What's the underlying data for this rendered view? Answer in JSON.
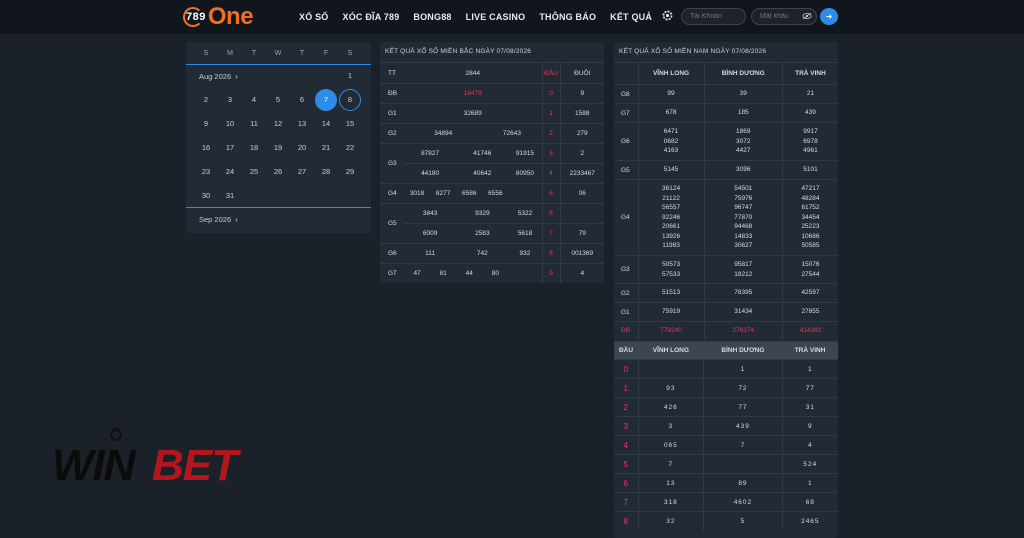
{
  "nav": {
    "logo_number": "789",
    "logo_word": "One",
    "items": [
      "XỔ SỐ",
      "XÓC ĐĨA 789",
      "BONG88",
      "LIVE CASINO",
      "THÔNG BÁO",
      "KẾT QUẢ"
    ],
    "username_placeholder": "Tài Khoản",
    "password_placeholder": "Mật khẩu",
    "login_icon": "arrow-right-icon",
    "settings_icon": "gear-icon",
    "eye_icon": "eye-off-icon"
  },
  "calendar": {
    "weekdays": [
      "S",
      "M",
      "T",
      "W",
      "T",
      "F",
      "S"
    ],
    "current_month": "Aug 2026",
    "next_month": "Sep 2026",
    "days": [
      "",
      "",
      "",
      "",
      "",
      "",
      "1",
      "2",
      "3",
      "4",
      "5",
      "6",
      "7",
      "8",
      "9",
      "10",
      "11",
      "12",
      "13",
      "14",
      "15",
      "16",
      "17",
      "18",
      "19",
      "20",
      "21",
      "22",
      "23",
      "24",
      "25",
      "26",
      "27",
      "28",
      "29",
      "30",
      "31"
    ],
    "selected_day": "7",
    "today_day": "8",
    "accent_color": "#2f8be8"
  },
  "mien_bac": {
    "title": "KẾT QUẢ XỔ SỐ MIỀN BẮC NGÀY 07/08/2026",
    "header": {
      "tt": "TT",
      "code": "2844",
      "dau": "ĐẦU",
      "duoi": "ĐUÔI"
    },
    "rows": [
      {
        "label": "ĐB",
        "values": [
          "16479"
        ],
        "red": true
      },
      {
        "label": "G1",
        "values": [
          "32689"
        ]
      },
      {
        "label": "G2",
        "values": [
          "34894",
          "72643"
        ]
      },
      {
        "label": "G3",
        "values": [
          "87827",
          "41746",
          "91915",
          "44180",
          "40642",
          "80950"
        ]
      },
      {
        "label": "G4",
        "values": [
          "3018",
          "8277",
          "6586",
          "6556"
        ]
      },
      {
        "label": "G5",
        "values": [
          "3843",
          "9329",
          "5322",
          "6009",
          "2583",
          "5618"
        ]
      },
      {
        "label": "G6",
        "values": [
          "111",
          "742",
          "932"
        ]
      },
      {
        "label": "G7",
        "values": [
          "47",
          "81",
          "44",
          "80"
        ]
      }
    ],
    "dau_duoi": [
      {
        "dau": "0",
        "duoi": "9"
      },
      {
        "dau": "1",
        "duoi": "1588"
      },
      {
        "dau": "2",
        "duoi": "279"
      },
      {
        "dau": "3",
        "duoi": "2"
      },
      {
        "dau": "4",
        "duoi": "2233467"
      },
      {
        "dau": "5",
        "duoi": "06"
      },
      {
        "dau": "6",
        "duoi": ""
      },
      {
        "dau": "7",
        "duoi": "79"
      },
      {
        "dau": "8",
        "duoi": "001369"
      },
      {
        "dau": "9",
        "duoi": "4"
      }
    ]
  },
  "mien_nam": {
    "title": "KẾT QUẢ XỔ SỐ MIỀN NAM NGÀY 07/08/2026",
    "provinces": [
      "VĨNH LONG",
      "BÌNH DƯƠNG",
      "TRÀ VINH"
    ],
    "rows": [
      {
        "label": "G8",
        "cells": [
          [
            "99"
          ],
          [
            "39"
          ],
          [
            "21"
          ]
        ]
      },
      {
        "label": "G7",
        "cells": [
          [
            "678"
          ],
          [
            "185"
          ],
          [
            "439"
          ]
        ]
      },
      {
        "label": "G6",
        "cells": [
          [
            "6471",
            "0682",
            "4163"
          ],
          [
            "1869",
            "3072",
            "4427"
          ],
          [
            "9917",
            "6978",
            "4961"
          ]
        ]
      },
      {
        "label": "G5",
        "cells": [
          [
            "5145"
          ],
          [
            "3096"
          ],
          [
            "5101"
          ]
        ]
      },
      {
        "label": "G4",
        "cells": [
          [
            "36124",
            "21122",
            "56557",
            "92246",
            "20661",
            "13926",
            "11983"
          ],
          [
            "54501",
            "75976",
            "96747",
            "77870",
            "94468",
            "14833",
            "30627"
          ],
          [
            "47217",
            "48284",
            "61752",
            "34454",
            "25223",
            "10686",
            "50585"
          ]
        ]
      },
      {
        "label": "G3",
        "cells": [
          [
            "50573",
            "57533"
          ],
          [
            "95817",
            "18212"
          ],
          [
            "15076",
            "27544"
          ]
        ]
      },
      {
        "label": "G2",
        "cells": [
          [
            "51513"
          ],
          [
            "78395"
          ],
          [
            "42597"
          ]
        ]
      },
      {
        "label": "G1",
        "cells": [
          [
            "75919"
          ],
          [
            "31434"
          ],
          [
            "27855"
          ]
        ]
      },
      {
        "label": "ĐB",
        "cells": [
          [
            "779240"
          ],
          [
            "276374"
          ],
          [
            "414382"
          ]
        ],
        "red": true
      }
    ],
    "dau_header": "ĐẦU",
    "dau_rows": [
      {
        "dau": "0",
        "values": [
          "",
          "1",
          "1"
        ]
      },
      {
        "dau": "1",
        "values": [
          "93",
          "72",
          "77"
        ]
      },
      {
        "dau": "2",
        "values": [
          "426",
          "77",
          "31"
        ]
      },
      {
        "dau": "3",
        "values": [
          "3",
          "439",
          "9"
        ]
      },
      {
        "dau": "4",
        "values": [
          "065",
          "7",
          "4"
        ]
      },
      {
        "dau": "5",
        "values": [
          "7",
          "",
          "524"
        ]
      },
      {
        "dau": "6",
        "values": [
          "13",
          "89",
          "1"
        ]
      },
      {
        "dau": "7",
        "values": [
          "318",
          "4602",
          "68"
        ]
      },
      {
        "dau": "8",
        "values": [
          "32",
          "5",
          "2465"
        ]
      }
    ]
  },
  "watermark": {
    "text": "WINBET"
  }
}
